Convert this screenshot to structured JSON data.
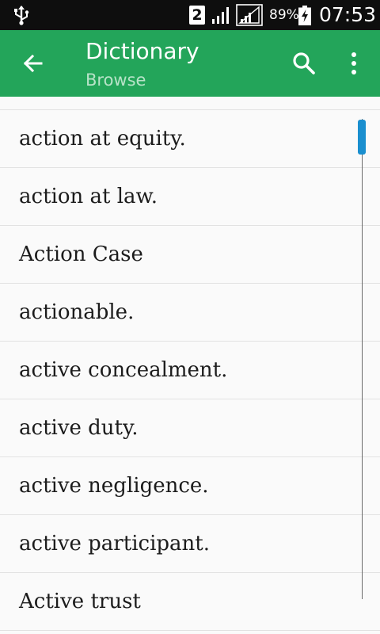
{
  "status_bar": {
    "sim_slot": "2",
    "battery_percent": "89%",
    "time": "07:53",
    "icons": [
      "usb-icon",
      "sim-2-icon",
      "signal-icon",
      "signal-icon",
      "battery-charging-icon"
    ]
  },
  "app_bar": {
    "title": "Dictionary",
    "subtitle": "Browse",
    "color": "#23a55a",
    "subtitle_color": "#b7e3c8",
    "icons": [
      "arrow-back-icon",
      "search-icon",
      "more-vert-icon"
    ]
  },
  "list": {
    "items": [
      {
        "label": "action at equity."
      },
      {
        "label": "action at law."
      },
      {
        "label": "Action Case"
      },
      {
        "label": "actionable."
      },
      {
        "label": "active concealment."
      },
      {
        "label": "active duty."
      },
      {
        "label": "active negligence."
      },
      {
        "label": "active participant."
      },
      {
        "label": "Active trust"
      }
    ],
    "scroll_position": 0.0,
    "scrollbar_color": "#1a8fcf"
  }
}
